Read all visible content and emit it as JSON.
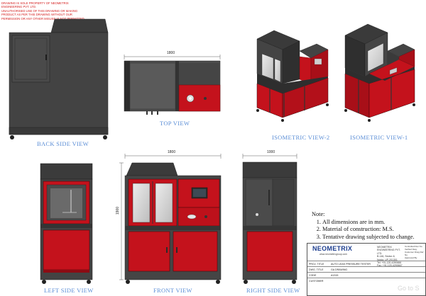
{
  "notice": "Drawing is sole property of NEOMETRIX ENGINEERING PVT. LTD.\nUnauthorised use of this drawing or making product as per this drawing without our permission or any other misuse is not permitted.",
  "views": {
    "back": "BACK SIDE VIEW",
    "top": "TOP VIEW",
    "iso2": "ISOMETRIC VIEW-2",
    "iso1": "ISOMETRIC VIEW-1",
    "left": "LEFT SIDE VIEW",
    "front": "FRONT VIEW",
    "right": "RIGHT SIDE VIEW"
  },
  "dimensions": {
    "top_width": "1800",
    "front_width": "1800",
    "right_width": "1000",
    "front_height": "1900"
  },
  "notes": {
    "title": "Note:",
    "items": [
      "All dimensions are in mm.",
      "Material of construction: M.S.",
      "Tentative drawing subjected to change."
    ]
  },
  "title_block": {
    "brand": "NEOMETRIX",
    "website": "www.neometrixgroup.com",
    "company": "NEOMETRIX ENGINEERING PVT. LTD.\nB-146, Sector-6, Noida, UP-201301\nTel: +91-120-4290666\nFax: +91-120-4290667",
    "right_info": "Controlled Doc No.\nVerified Dwg.\nCustomer Drwg Ref No.\nApproved By:",
    "rows": [
      {
        "label": "PROJ. TITLE",
        "value": "AUTO LEAK PRESSURE TESTER"
      },
      {
        "label": "DWG. TITLE",
        "value": "GA DRAWING"
      },
      {
        "label": "CODE",
        "value": "A1315"
      },
      {
        "label": "CUSTOMER",
        "value": ""
      }
    ]
  },
  "watermark": "Go to S",
  "colors": {
    "cabinet_dark": "#3a3a3a",
    "cabinet_mid": "#555555",
    "accent_red": "#c4121c",
    "label_blue": "#5b8ed6",
    "notice_red": "#d41c1c"
  }
}
